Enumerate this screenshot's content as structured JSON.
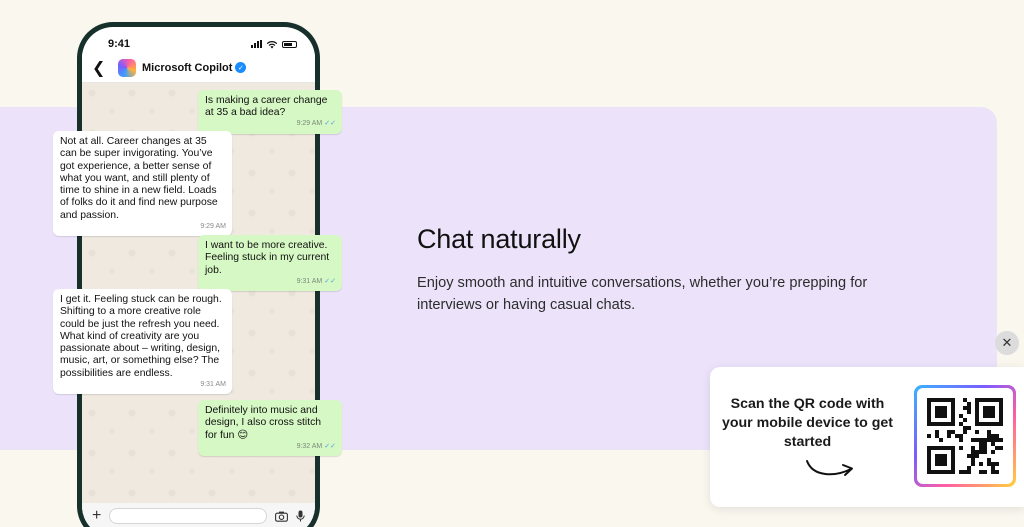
{
  "phone": {
    "status": {
      "time": "9:41"
    },
    "header": {
      "contact_name": "Microsoft Copilot"
    },
    "messages": [
      {
        "dir": "out",
        "text": "Is making a career change at 35 a bad idea?",
        "time": "9:29 AM"
      },
      {
        "dir": "in",
        "text": "Not at all. Career changes at 35 can be super invigorating. You’ve got experience, a better sense of what you want, and still plenty of time to shine in a new field. Loads of folks do it and find new purpose and passion.",
        "time": "9:29 AM"
      },
      {
        "dir": "out",
        "text": "I want to be more creative. Feeling stuck in my current job.",
        "time": "9:31 AM"
      },
      {
        "dir": "in",
        "text": "I get it. Feeling stuck can be rough. Shifting to a more creative role could be just the refresh you need. What kind of creativity are you passionate about – writing, design, music, art, or something else? The possibilities are endless.",
        "time": "9:31 AM"
      },
      {
        "dir": "out",
        "text": "Definitely into music and design, I also cross stitch for fun 😊",
        "time": "9:32 AM"
      }
    ]
  },
  "hero": {
    "heading": "Chat naturally",
    "description": "Enjoy smooth and intuitive conversations, whether you’re prepping for interviews or having casual chats."
  },
  "qr_card": {
    "text": "Scan the QR code with your mobile device to get started",
    "close_icon": "close-icon"
  },
  "colors": {
    "band": "#ece3fb",
    "page": "#faf7ef",
    "out_bubble": "#d6f8c4",
    "in_bubble": "#ffffff",
    "verified": "#1a8cff",
    "phone_frame": "#17302b"
  }
}
